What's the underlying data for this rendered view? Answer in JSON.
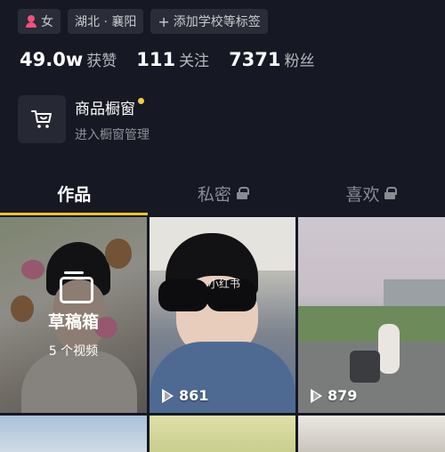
{
  "profile": {
    "tags": [
      {
        "icon": "female-person-icon",
        "label": "女"
      },
      {
        "label": "湖北 · 襄阳"
      },
      {
        "icon": "plus-icon",
        "label": "添加学校等标签"
      }
    ],
    "stats": [
      {
        "value": "49.0w",
        "label": "获赞"
      },
      {
        "value": "111",
        "label": "关注"
      },
      {
        "value": "7371",
        "label": "粉丝"
      }
    ]
  },
  "shop": {
    "icon": "shopping-cart-icon",
    "title": "商品橱窗",
    "subtitle": "进入橱窗管理",
    "dot_color": "#f9c846"
  },
  "tabs": [
    {
      "label": "作品",
      "active": true
    },
    {
      "label": "私密",
      "locked": true
    },
    {
      "label": "喜欢",
      "locked": true
    }
  ],
  "accent_color": "#f7c42b",
  "grid": {
    "draft": {
      "title": "草稿箱",
      "count": "5 个视频"
    },
    "videos": [
      {
        "plays": "861",
        "watermark": "小红书"
      },
      {
        "plays": "879"
      }
    ]
  }
}
